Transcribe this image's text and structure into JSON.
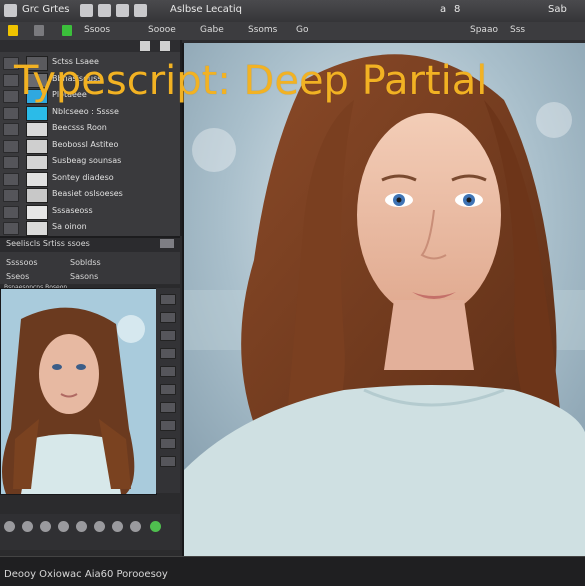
{
  "overlay": {
    "title": "Typescript: Deep Partial"
  },
  "menubar": {
    "items": [
      "Grc Grtes",
      "Aslbse Lecatiq",
      "a",
      "8"
    ],
    "right_text": "Sab"
  },
  "toolbar": {
    "items": [
      "Ssoos",
      "Soooe",
      "Gabe",
      "Ssoms",
      "Go",
      "Spaao",
      "Sss"
    ]
  },
  "layers_panel": {
    "rows": [
      {
        "label": "Sctss Lsaee",
        "thumb": "#5a5a5e"
      },
      {
        "label": "Bbnasiseuss",
        "thumb": "#6a6a6e"
      },
      {
        "label": "Plotaeee",
        "thumb": "#2fa8e0"
      },
      {
        "label": "Nblcseeo : Sssse",
        "thumb": "#2bbbe8"
      },
      {
        "label": "Beecsss Roon",
        "thumb": "#d9d9d9"
      },
      {
        "label": "Beobossl Astiteo",
        "thumb": "#cfcfcf"
      },
      {
        "label": "Susbeag sounsas",
        "thumb": "#d4d4d4"
      },
      {
        "label": "Sontey diadeso",
        "thumb": "#e1e1e1"
      },
      {
        "label": "Beasiet oslsoeses",
        "thumb": "#c8c8c8"
      },
      {
        "label": "Sssaseoss",
        "thumb": "#e6e6e6"
      },
      {
        "label": "Sa oinon",
        "thumb": "#dadada"
      }
    ]
  },
  "sub_panel": {
    "header": "Seeliscls Srtiss ssoes",
    "row1": [
      "Ssssoos",
      "Sobldss"
    ],
    "row2": [
      "Sseos",
      "Sasons"
    ],
    "row3": "Bsnaesoncns Boseon"
  },
  "status": {
    "text": "Deooy Oxiowac Aia60 Porooesoy"
  },
  "colors": {
    "overlay": "#f2b223",
    "panel": "#3a3a3d",
    "accent": "#2fa8e0"
  }
}
